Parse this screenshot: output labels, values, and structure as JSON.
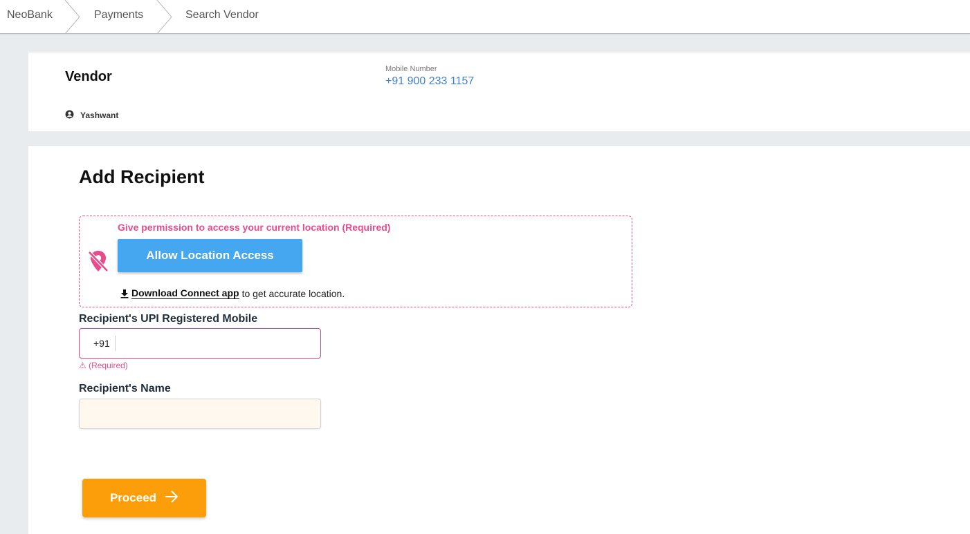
{
  "breadcrumb": {
    "items": [
      {
        "label": "NeoBank"
      },
      {
        "label": "Payments"
      },
      {
        "label": "Search Vendor"
      }
    ]
  },
  "vendor": {
    "title": "Vendor",
    "user_icon": "user-circle-icon",
    "user_name": "Yashwant",
    "mobile_label": "Mobile Number",
    "mobile_value": "+91 900 233 1157"
  },
  "recipient_form": {
    "title": "Add Recipient",
    "location": {
      "icon": "location-off-icon",
      "message": "Give permission to access your current location (Required)",
      "allow_button": "Allow Location Access",
      "download_icon": "download-icon",
      "download_link": "Download Connect app",
      "download_suffix": "to get accurate location."
    },
    "mobile_field": {
      "label": "Recipient's UPI Registered Mobile",
      "prefix": "+91",
      "value": "",
      "error": "⚠ (Required)"
    },
    "name_field": {
      "label": "Recipient's Name",
      "value": ""
    },
    "proceed_button": "Proceed",
    "proceed_icon": "arrow-right-icon"
  },
  "colors": {
    "accent_pink": "#e94a8a",
    "button_blue": "#45a7ef",
    "button_orange": "#fb9e0a",
    "link_blue": "#3f7fd0"
  }
}
